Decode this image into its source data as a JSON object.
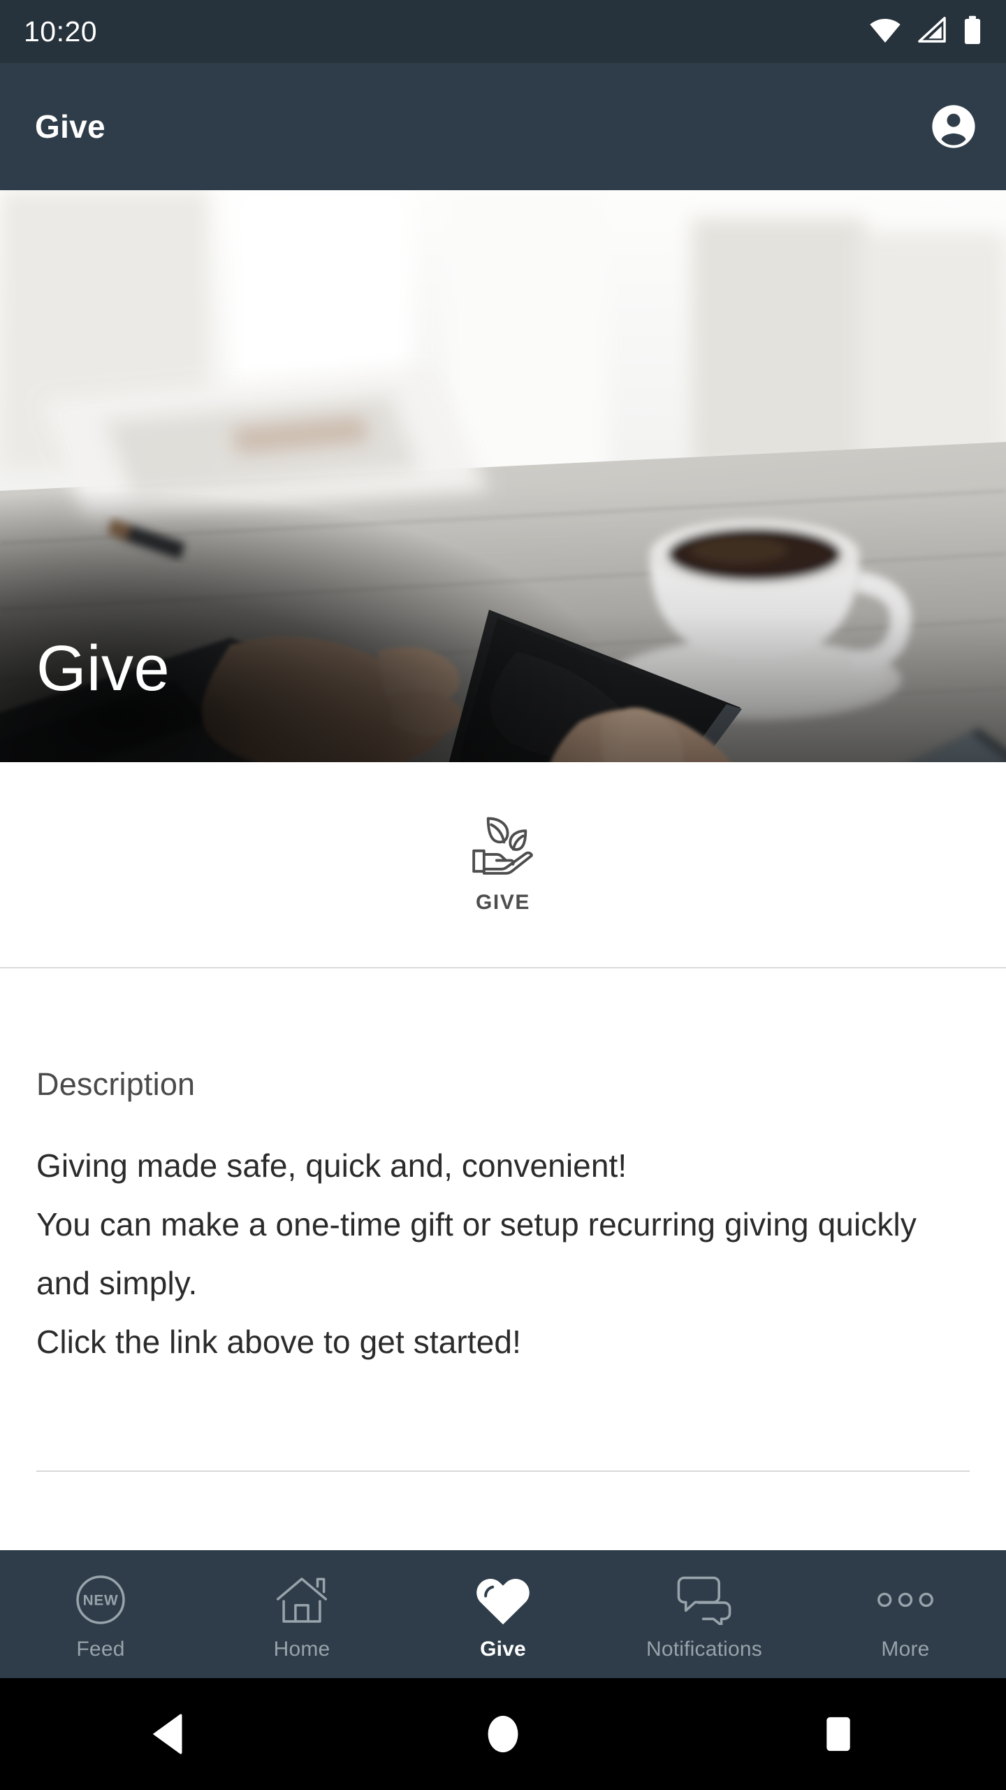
{
  "status_bar": {
    "time": "10:20",
    "icons": [
      "wifi-icon",
      "cellular-signal-icon",
      "battery-icon"
    ]
  },
  "app_bar": {
    "title": "Give",
    "account_icon": "account-circle-icon"
  },
  "hero": {
    "title": "Give",
    "image_description": "hands holding a tablet on a light wooden table with a coffee cup, a smartphone and an open notebook"
  },
  "tile": {
    "label": "GIVE",
    "icon": "hand-with-leaves-icon"
  },
  "description": {
    "heading": "Description",
    "body": "Giving made safe, quick and, convenient!\nYou can make a one-time gift or setup recurring giving quickly and simply.\nClick the link above to get started!"
  },
  "bottom_nav": {
    "items": [
      {
        "label": "Feed",
        "icon": "new-badge-circle-icon",
        "active": false
      },
      {
        "label": "Home",
        "icon": "house-icon",
        "active": false
      },
      {
        "label": "Give",
        "icon": "heart-icon",
        "active": true
      },
      {
        "label": "Notifications",
        "icon": "chat-bubbles-icon",
        "active": false
      },
      {
        "label": "More",
        "icon": "three-dots-icon",
        "active": false
      }
    ],
    "feed_badge_text": "NEW"
  },
  "android_nav": {
    "back": "back-triangle-icon",
    "home": "home-circle-icon",
    "recents": "recents-square-icon"
  },
  "colors": {
    "status_bar_bg": "#27333c",
    "app_bar_bg": "#2e3d49",
    "bottom_nav_bg": "#2e3d49",
    "active_tab": "#ffffff",
    "inactive_tab": "#98a3ab",
    "body_text": "#2b2b2b",
    "heading_text": "#4a4a4a"
  }
}
